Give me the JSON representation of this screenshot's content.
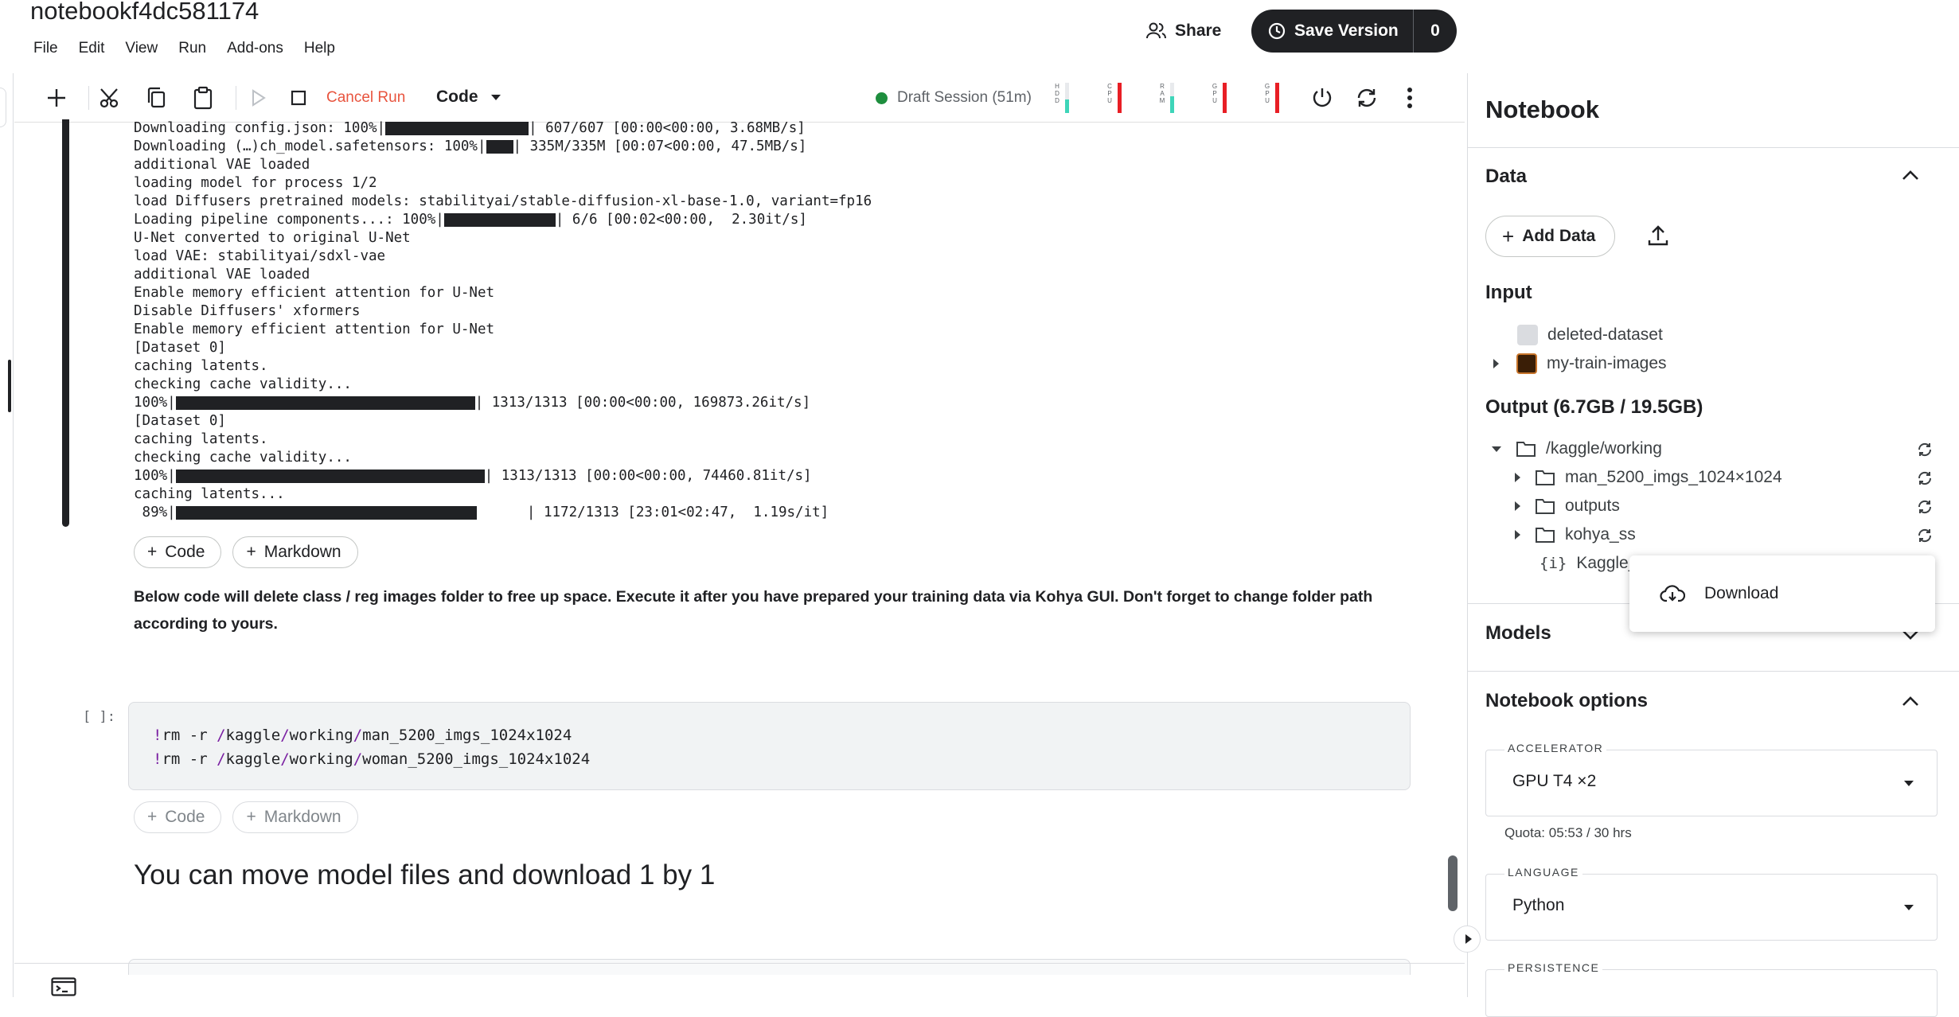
{
  "app": {
    "title": "notebookf4dc581174",
    "menu": [
      "File",
      "Edit",
      "View",
      "Run",
      "Add-ons",
      "Help"
    ],
    "share_label": "Share",
    "save_label": "Save Version",
    "save_count": "0"
  },
  "toolbar": {
    "cancel_run": "Cancel Run",
    "cell_type": "Code",
    "session": "Draft Session (51m)",
    "meters": [
      {
        "label": [
          "H",
          "D",
          "D"
        ],
        "fill": 0.45,
        "color": "#3ed5b9"
      },
      {
        "label": [
          "C",
          "P",
          "U"
        ],
        "fill": 1.0,
        "color": "#e81e25"
      },
      {
        "label": [
          "R",
          "A",
          "M"
        ],
        "fill": 0.55,
        "color": "#3ed5b9"
      },
      {
        "label": [
          "G",
          "P",
          "U"
        ],
        "fill": 1.0,
        "color": "#e81e25"
      },
      {
        "label": [
          "G",
          "P",
          "U"
        ],
        "fill": 1.0,
        "color": "#e81e25"
      }
    ]
  },
  "output": {
    "lines": [
      {
        "pre": "Downloading config.json: 100%|",
        "bar": 180,
        "post": "| 607/607 [00:00<00:00, 3.68MB/s]"
      },
      {
        "pre": "Downloading (…)ch_model.safetensors: 100%|",
        "bar": 34,
        "post": "| 335M/335M [00:07<00:00, 47.5MB/s]"
      },
      {
        "pre": "additional VAE loaded"
      },
      {
        "pre": "loading model for process 1/2"
      },
      {
        "pre": "load Diffusers pretrained models: stabilityai/stable-diffusion-xl-base-1.0, variant=fp16"
      },
      {
        "pre": "Loading pipeline components...: 100%|",
        "bar": 140,
        "post": "| 6/6 [00:02<00:00,  2.30it/s]"
      },
      {
        "pre": "U-Net converted to original U-Net"
      },
      {
        "pre": "load VAE: stabilityai/sdxl-vae"
      },
      {
        "pre": "additional VAE loaded"
      },
      {
        "pre": "Enable memory efficient attention for U-Net"
      },
      {
        "pre": "Disable Diffusers' xformers"
      },
      {
        "pre": "Enable memory efficient attention for U-Net"
      },
      {
        "pre": "[Dataset 0]"
      },
      {
        "pre": "caching latents."
      },
      {
        "pre": "checking cache validity..."
      },
      {
        "pre": "100%|",
        "bar": 376,
        "post": "| 1313/1313 [00:00<00:00, 169873.26it/s]"
      },
      {
        "pre": "[Dataset 0]"
      },
      {
        "pre": "caching latents."
      },
      {
        "pre": "checking cache validity..."
      },
      {
        "pre": "100%|",
        "bar": 388,
        "post": "| 1313/1313 [00:00<00:00, 74460.81it/s]"
      },
      {
        "pre": "caching latents..."
      },
      {
        "pre": " 89%|",
        "bar": 378,
        "post": "      | 1172/1313 [23:01<02:47,  1.19s/it]"
      }
    ]
  },
  "cells": {
    "add_code": "Code",
    "add_markdown": "Markdown",
    "md_text": "Below code will delete class / reg images folder to free up space. Execute it after you have prepared your training data via Kohya GUI. Don't forget to change folder path according to yours.",
    "prompt": "[ ]:",
    "code_lines": [
      [
        "!rm -r ",
        "/",
        "kaggle",
        "/",
        "working",
        "/",
        "man_5200_imgs_1024x1024"
      ],
      [
        "!rm -r ",
        "/",
        "kaggle",
        "/",
        "working",
        "/",
        "woman_5200_imgs_1024x1024"
      ]
    ],
    "heading": "You can move model files and download 1 by 1"
  },
  "panel": {
    "title": "Notebook",
    "data_section": "Data",
    "add_data": "Add Data",
    "input_heading": "Input",
    "inputs": [
      "deleted-dataset",
      "my-train-images"
    ],
    "output_heading": "Output (6.7GB / 19.5GB)",
    "output_root": "/kaggle/working",
    "output_children": [
      "man_5200_imgs_1024×1024",
      "outputs",
      "kohya_ss",
      "Kaggle_"
    ],
    "context_menu": "Download",
    "models_section": "Models",
    "options_section": "Notebook options",
    "accelerator_label": "ACCELERATOR",
    "accelerator_value": "GPU T4 ×2",
    "quota": "Quota: 05:53 / 30 hrs",
    "language_label": "LANGUAGE",
    "language_value": "Python",
    "persistence_label": "PERSISTENCE"
  }
}
